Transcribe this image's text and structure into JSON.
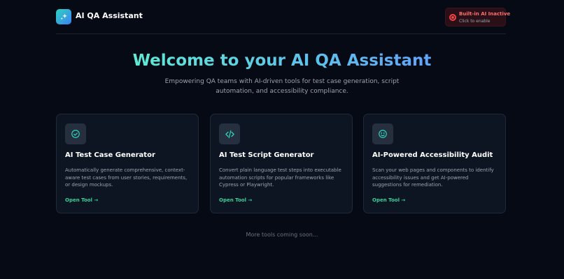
{
  "header": {
    "app_title": "AI QA Assistant",
    "logo_icon": "sparkles-icon",
    "status": {
      "title": "Built-in AI Inactive",
      "subtitle": "Click to enable",
      "color": "#ef4444"
    }
  },
  "hero": {
    "title": "Welcome to your AI QA Assistant",
    "subtitle": "Empowering QA teams with AI-driven tools for test case generation, script automation, and accessibility compliance."
  },
  "cards": [
    {
      "icon": "check-circle-icon",
      "title": "AI Test Case Generator",
      "description": "Automatically generate comprehensive, context-aware test cases from user stories, requirements, or design mockups.",
      "link": "Open Tool →"
    },
    {
      "icon": "code-icon",
      "title": "AI Test Script Generator",
      "description": "Convert plain language test steps into executable automation scripts for popular frameworks like Cypress or Playwright.",
      "link": "Open Tool →"
    },
    {
      "icon": "smiley-icon",
      "title": "AI-Powered Accessibility Audit",
      "description": "Scan your web pages and components to identify accessibility issues and get AI-powered suggestions for remediation.",
      "link": "Open Tool →"
    }
  ],
  "footer": {
    "note": "More tools coming soon..."
  },
  "colors": {
    "accent_teal": "#2dd4bf",
    "accent_blue": "#3b82f6",
    "link_green": "#34d399"
  }
}
